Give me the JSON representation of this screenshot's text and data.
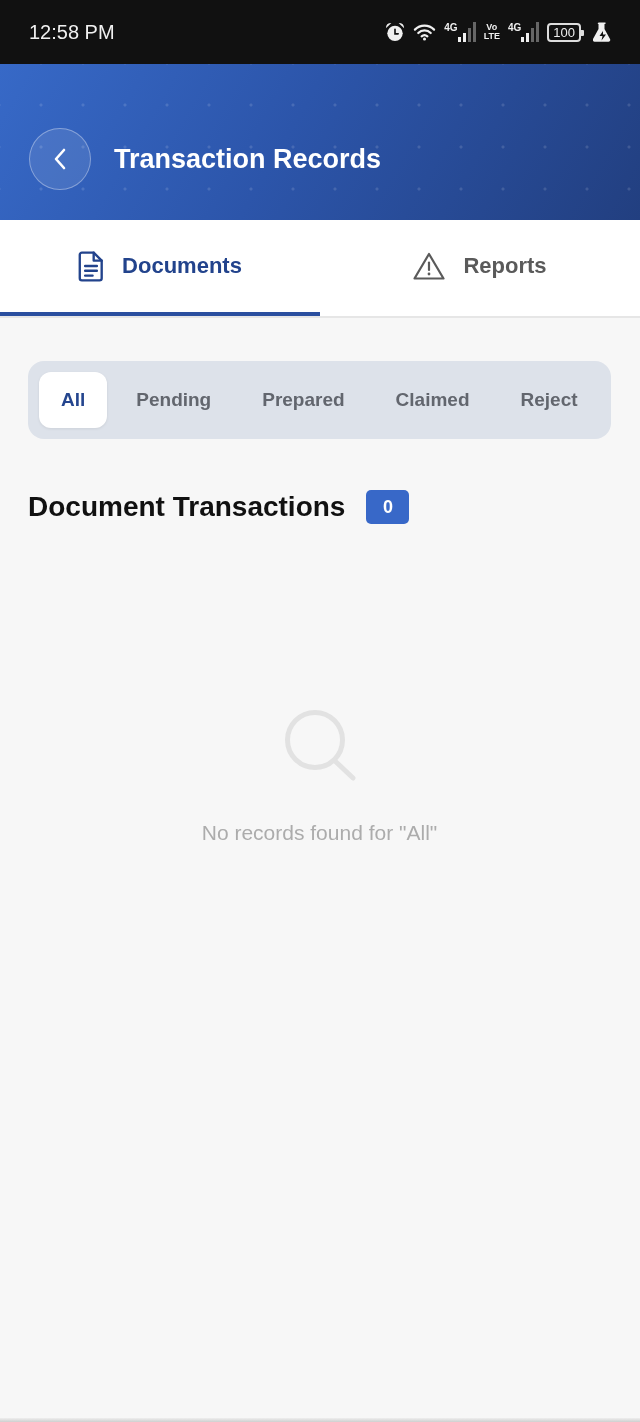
{
  "status_bar": {
    "time": "12:58 PM",
    "indicators": [
      {
        "kind": "alarm"
      },
      {
        "kind": "wifi"
      },
      {
        "kind": "signal",
        "label": "4G"
      },
      {
        "kind": "volte",
        "label": "Vo LTE"
      },
      {
        "kind": "signal",
        "label": "4G"
      },
      {
        "kind": "battery",
        "label": "100"
      },
      {
        "kind": "flask"
      }
    ]
  },
  "header": {
    "title": "Transaction Records"
  },
  "tabs": [
    {
      "label": "Documents",
      "selected": true
    },
    {
      "label": "Reports",
      "selected": false
    }
  ],
  "filters": [
    {
      "label": "All",
      "selected": true
    },
    {
      "label": "Pending",
      "selected": false
    },
    {
      "label": "Prepared",
      "selected": false
    },
    {
      "label": "Claimed",
      "selected": false
    },
    {
      "label": "Reject",
      "selected": false
    }
  ],
  "section": {
    "title": "Document Transactions",
    "count": "0"
  },
  "empty_state": {
    "message": "No records found for \"All\""
  }
}
